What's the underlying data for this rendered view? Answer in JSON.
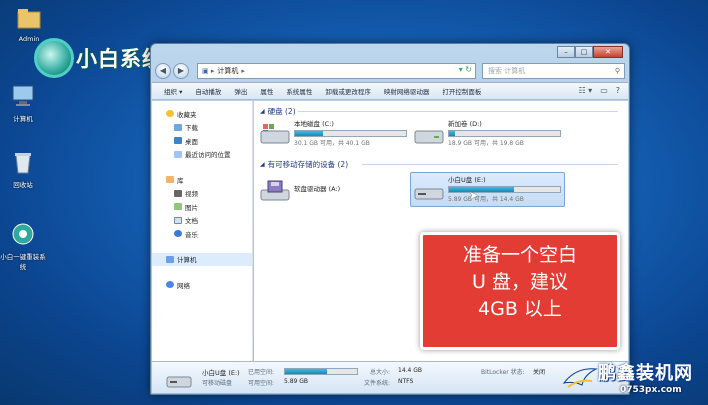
{
  "desktop": {
    "icons": [
      {
        "label": "Admin",
        "icon": "user-folder-icon"
      },
      {
        "label": "计算机",
        "icon": "computer-icon"
      },
      {
        "label": "回收站",
        "icon": "recycle-bin-icon"
      },
      {
        "label": "小白一键重装系统",
        "icon": "app-icon"
      }
    ],
    "logo_text": "小白系统"
  },
  "window": {
    "address": "计算机",
    "search_placeholder": "搜索 计算机",
    "toolbar": [
      "组织 ▾",
      "自动播放",
      "弹出",
      "属性",
      "系统属性",
      "卸载或更改程序",
      "映射网络驱动器",
      "打开控制面板"
    ],
    "nav": {
      "favorites": {
        "label": "收藏夹",
        "items": [
          "下载",
          "桌面",
          "最近访问的位置"
        ]
      },
      "libraries": {
        "label": "库",
        "items": [
          "视频",
          "图片",
          "文档",
          "音乐"
        ]
      },
      "computer": "计算机",
      "network": "网络"
    },
    "groups": {
      "hard_disks": "硬盘 (2)",
      "removable": "有可移动存储的设备 (2)"
    },
    "drives": [
      {
        "name": "本地磁盘 (C:)",
        "size": "30.1 GB 可用，共 40.1 GB",
        "used_fraction": 0.25
      },
      {
        "name": "新加卷 (D:)",
        "size": "18.9 GB 可用，共 19.8 GB",
        "used_fraction": 0.05
      },
      {
        "name": "软盘驱动器 (A:)"
      },
      {
        "name": "小白U盘 (E:)",
        "size": "5.89 GB 可用，共 14.4 GB",
        "used_fraction": 0.59
      }
    ],
    "details": {
      "name": "小白U盘 (E:)",
      "type": "可移动磁盘",
      "used_label": "已用空间:",
      "free_label": "可用空间:",
      "free_value": "5.89 GB",
      "total_label": "总大小:",
      "total_value": "14.4 GB",
      "fs_label": "文件系统:",
      "fs_value": "NTFS",
      "bitlocker_label": "BitLocker 状态:",
      "bitlocker_value": "关闭",
      "used_fraction": 0.59
    }
  },
  "callout": {
    "line1": "准备一个空白",
    "line2": "U 盘，建议",
    "line3": "4GB 以上"
  },
  "watermark": {
    "title": "鹏鑫装机网",
    "url": "0753px.com"
  },
  "colors": {
    "callout_bg": "#e23c35",
    "bar_fill": "#1a86b3"
  }
}
